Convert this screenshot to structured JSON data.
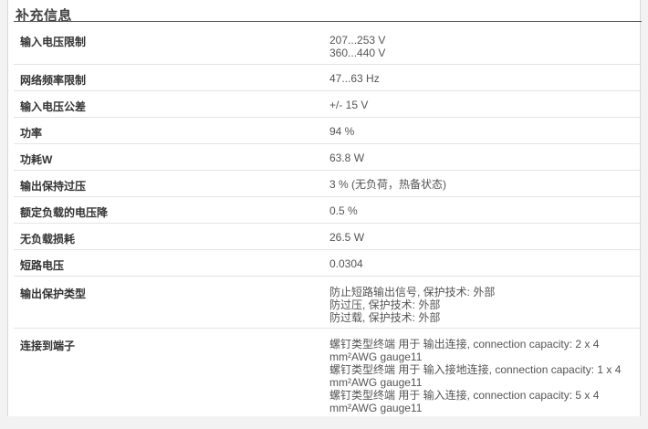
{
  "section": {
    "title": "补充信息"
  },
  "rows": [
    {
      "label": "输入电压限制",
      "values": [
        "207...253 V",
        "360...440 V"
      ]
    },
    {
      "label": "网络频率限制",
      "values": [
        "47...63 Hz"
      ]
    },
    {
      "label": "输入电压公差",
      "values": [
        "+/- 15 V"
      ]
    },
    {
      "label": "功率",
      "values": [
        "94 %"
      ]
    },
    {
      "label": "功耗W",
      "values": [
        "63.8 W"
      ]
    },
    {
      "label": "输出保持过压",
      "values": [
        "3 % (无负荷，热备状态)"
      ]
    },
    {
      "label": "额定负载的电压降",
      "values": [
        "0.5 %"
      ]
    },
    {
      "label": "无负载损耗",
      "values": [
        "26.5 W"
      ]
    },
    {
      "label": "短路电压",
      "values": [
        "0.0304"
      ]
    },
    {
      "label": "输出保护类型",
      "values": [
        "防止短路输出信号, 保护技术: 外部",
        "防过压, 保护技术: 外部",
        "防过载, 保护技术: 外部"
      ]
    },
    {
      "label": "连接到端子",
      "values": [
        "螺钉类型终端 用于 输出连接, connection capacity: 2 x 4 mm²AWG gauge11",
        "螺钉类型终端 用于 输入接地连接, connection capacity: 1 x 4 mm²AWG gauge11",
        "螺钉类型终端 用于 输入连接, connection capacity: 5 x 4 mm²AWG gauge11"
      ]
    }
  ]
}
